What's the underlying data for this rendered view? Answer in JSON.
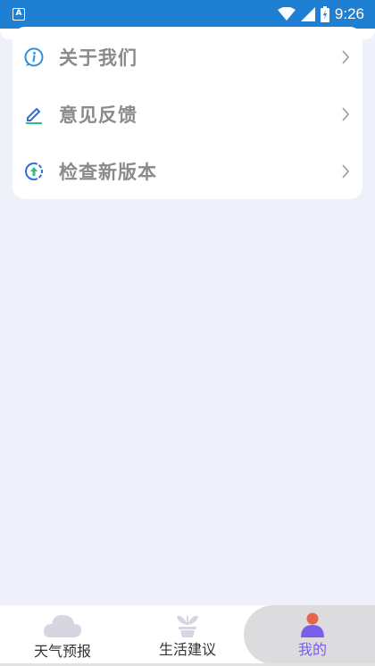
{
  "status_bar": {
    "time": "9:26",
    "app_icon_letter": "A",
    "icons": [
      "wifi-icon",
      "signal-icon",
      "battery-icon"
    ]
  },
  "menu": {
    "items": [
      {
        "label": "关于我们",
        "icon": "info-icon"
      },
      {
        "label": "意见反馈",
        "icon": "edit-icon"
      },
      {
        "label": "检查新版本",
        "icon": "update-icon"
      }
    ]
  },
  "tabbar": {
    "tabs": [
      {
        "label": "天气预报",
        "icon": "cloud-icon",
        "active": false
      },
      {
        "label": "生活建议",
        "icon": "plant-icon",
        "active": false
      },
      {
        "label": "我的",
        "icon": "person-icon",
        "active": true
      }
    ],
    "active_color": "#7a5ee8"
  },
  "colors": {
    "status_bar": "#1e7fd3",
    "background": "#eef0fa"
  }
}
